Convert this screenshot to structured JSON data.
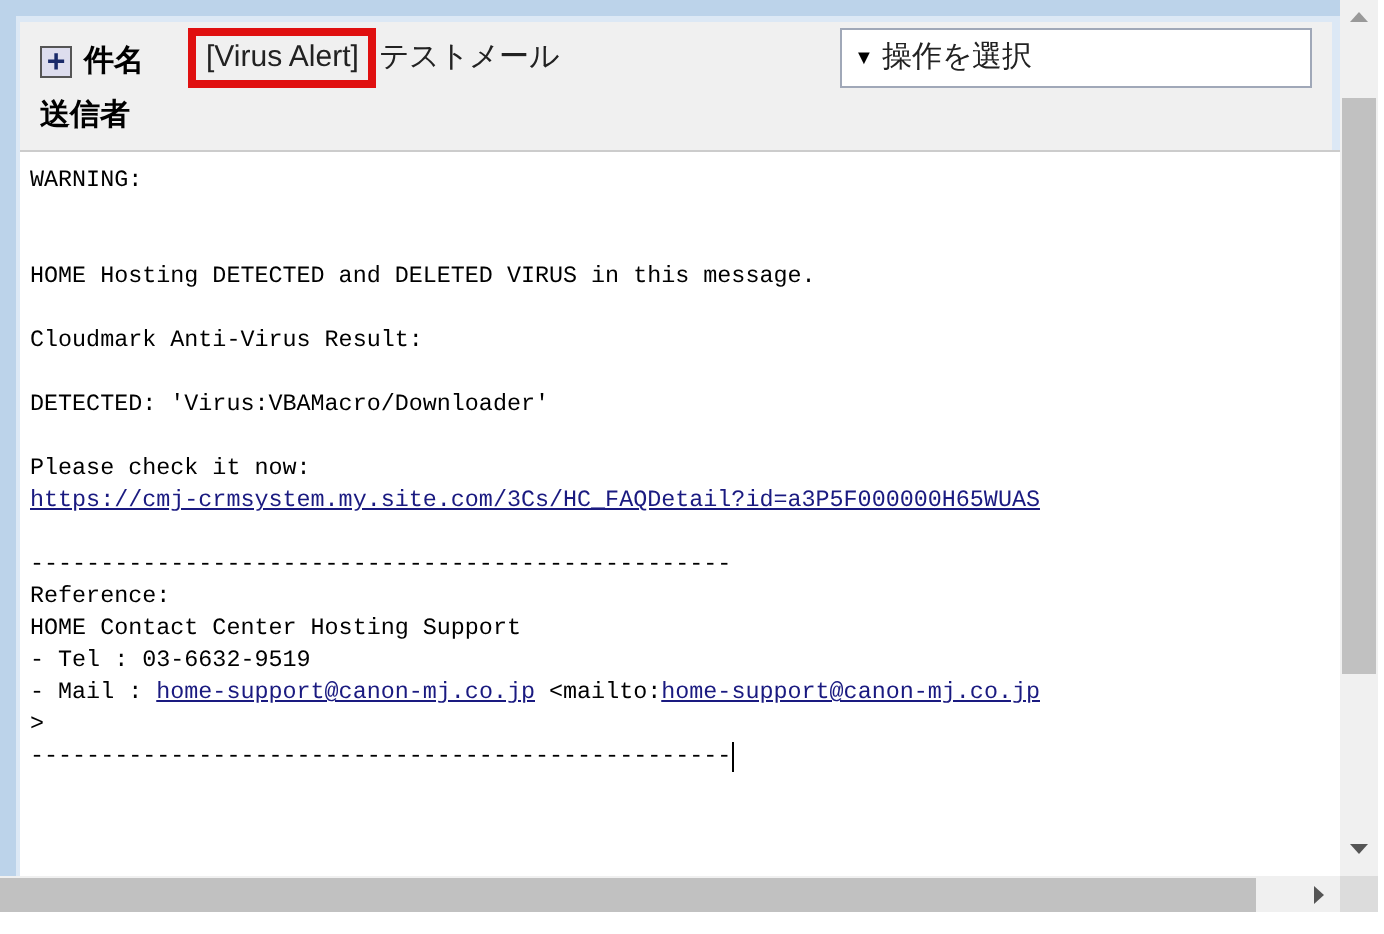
{
  "header": {
    "expand_icon": "+",
    "subject_label": "件名",
    "subject_tag": "[Virus Alert]",
    "subject_text": "テストメール",
    "sender_label": "送信者",
    "action_select": {
      "caret": "▼",
      "placeholder": "操作を選択"
    }
  },
  "body": {
    "lines": [
      {
        "kind": "text",
        "segments": [
          {
            "text": "WARNING:",
            "link": false
          }
        ]
      },
      {
        "kind": "blank"
      },
      {
        "kind": "blank"
      },
      {
        "kind": "text",
        "segments": [
          {
            "text": "HOME Hosting DETECTED and DELETED VIRUS in this message.",
            "link": false
          }
        ]
      },
      {
        "kind": "blank"
      },
      {
        "kind": "text",
        "segments": [
          {
            "text": "Cloudmark Anti-Virus Result:",
            "link": false
          }
        ]
      },
      {
        "kind": "blank"
      },
      {
        "kind": "text",
        "segments": [
          {
            "text": "DETECTED: 'Virus:VBAMacro/Downloader'",
            "link": false
          }
        ]
      },
      {
        "kind": "blank"
      },
      {
        "kind": "text",
        "segments": [
          {
            "text": "Please check it now:",
            "link": false
          }
        ]
      },
      {
        "kind": "text",
        "segments": [
          {
            "text": "https://cmj-crmsystem.my.site.com/3Cs/HC_FAQDetail?id=a3P5F000000H65WUAS",
            "link": true
          }
        ]
      },
      {
        "kind": "blank"
      },
      {
        "kind": "text",
        "segments": [
          {
            "text": "--------------------------------------------------",
            "link": false
          }
        ]
      },
      {
        "kind": "text",
        "segments": [
          {
            "text": "Reference:",
            "link": false
          }
        ]
      },
      {
        "kind": "text",
        "segments": [
          {
            "text": "HOME Contact Center Hosting Support",
            "link": false
          }
        ]
      },
      {
        "kind": "text",
        "segments": [
          {
            "text": "- Tel : 03-6632-9519",
            "link": false
          }
        ]
      },
      {
        "kind": "text",
        "segments": [
          {
            "text": "- Mail : ",
            "link": false
          },
          {
            "text": "home-support@canon-mj.co.jp",
            "link": true
          },
          {
            "text": " <mailto:",
            "link": false
          },
          {
            "text": "home-support@canon-mj.co.jp",
            "link": true
          }
        ]
      },
      {
        "kind": "text",
        "segments": [
          {
            "text": ">",
            "link": false
          }
        ]
      },
      {
        "kind": "text",
        "cursor": true,
        "segments": [
          {
            "text": "--------------------------------------------------",
            "link": false
          }
        ]
      }
    ]
  }
}
